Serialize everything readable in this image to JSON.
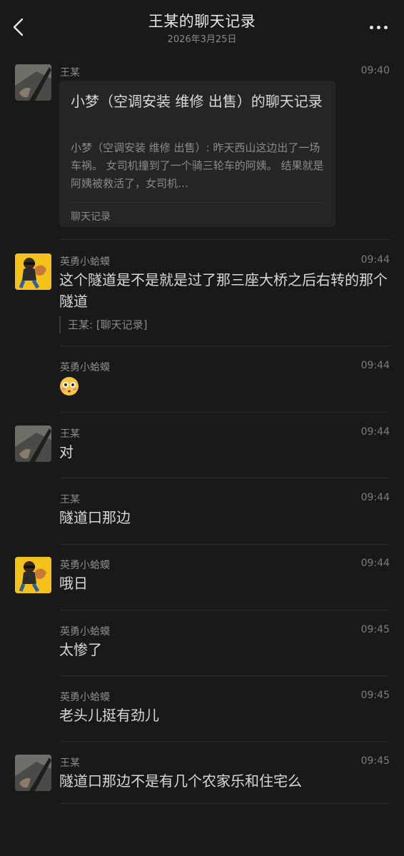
{
  "header": {
    "title": "王某的聊天记录",
    "date": "2026年3月25日"
  },
  "messages": [
    {
      "sender": "王某",
      "time": "09:40",
      "avatar": "wang",
      "card": {
        "title": "小梦（空调安装 维修 出售）的聊天记录",
        "preview": "小梦（空调安装 维修 出售）: 昨天西山这边出了一场车祸。 女司机撞到了一个骑三轮车的阿姨。 结果就是阿姨被救活了，女司机…",
        "footer": "聊天记录"
      }
    },
    {
      "sender": "英勇小蛤蟆",
      "time": "09:44",
      "avatar": "frog",
      "text": "这个隧道是不是就是过了那三座大桥之后右转的那个隧道",
      "quote": "王某: [聊天记录]"
    },
    {
      "sender": "英勇小蛤蟆",
      "time": "09:44",
      "emoji": "flushed-face-icon"
    },
    {
      "sender": "王某",
      "time": "09:44",
      "avatar": "wang",
      "text": "对"
    },
    {
      "sender": "王某",
      "time": "09:44",
      "text": "隧道口那边"
    },
    {
      "sender": "英勇小蛤蟆",
      "time": "09:44",
      "avatar": "frog",
      "text": "哦日"
    },
    {
      "sender": "英勇小蛤蟆",
      "time": "09:45",
      "text": "太惨了"
    },
    {
      "sender": "英勇小蛤蟆",
      "time": "09:45",
      "text": "老头儿挺有劲儿"
    },
    {
      "sender": "王某",
      "time": "09:45",
      "avatar": "wang",
      "text": "隧道口那边不是有几个农家乐和住宅么"
    }
  ],
  "colors": {
    "background": "#191919",
    "card": "#252525",
    "avatar_frog_bg": "#f3c21a"
  },
  "icons": [
    "back-chevron-icon",
    "more-dots-icon",
    "flushed-face-icon"
  ]
}
